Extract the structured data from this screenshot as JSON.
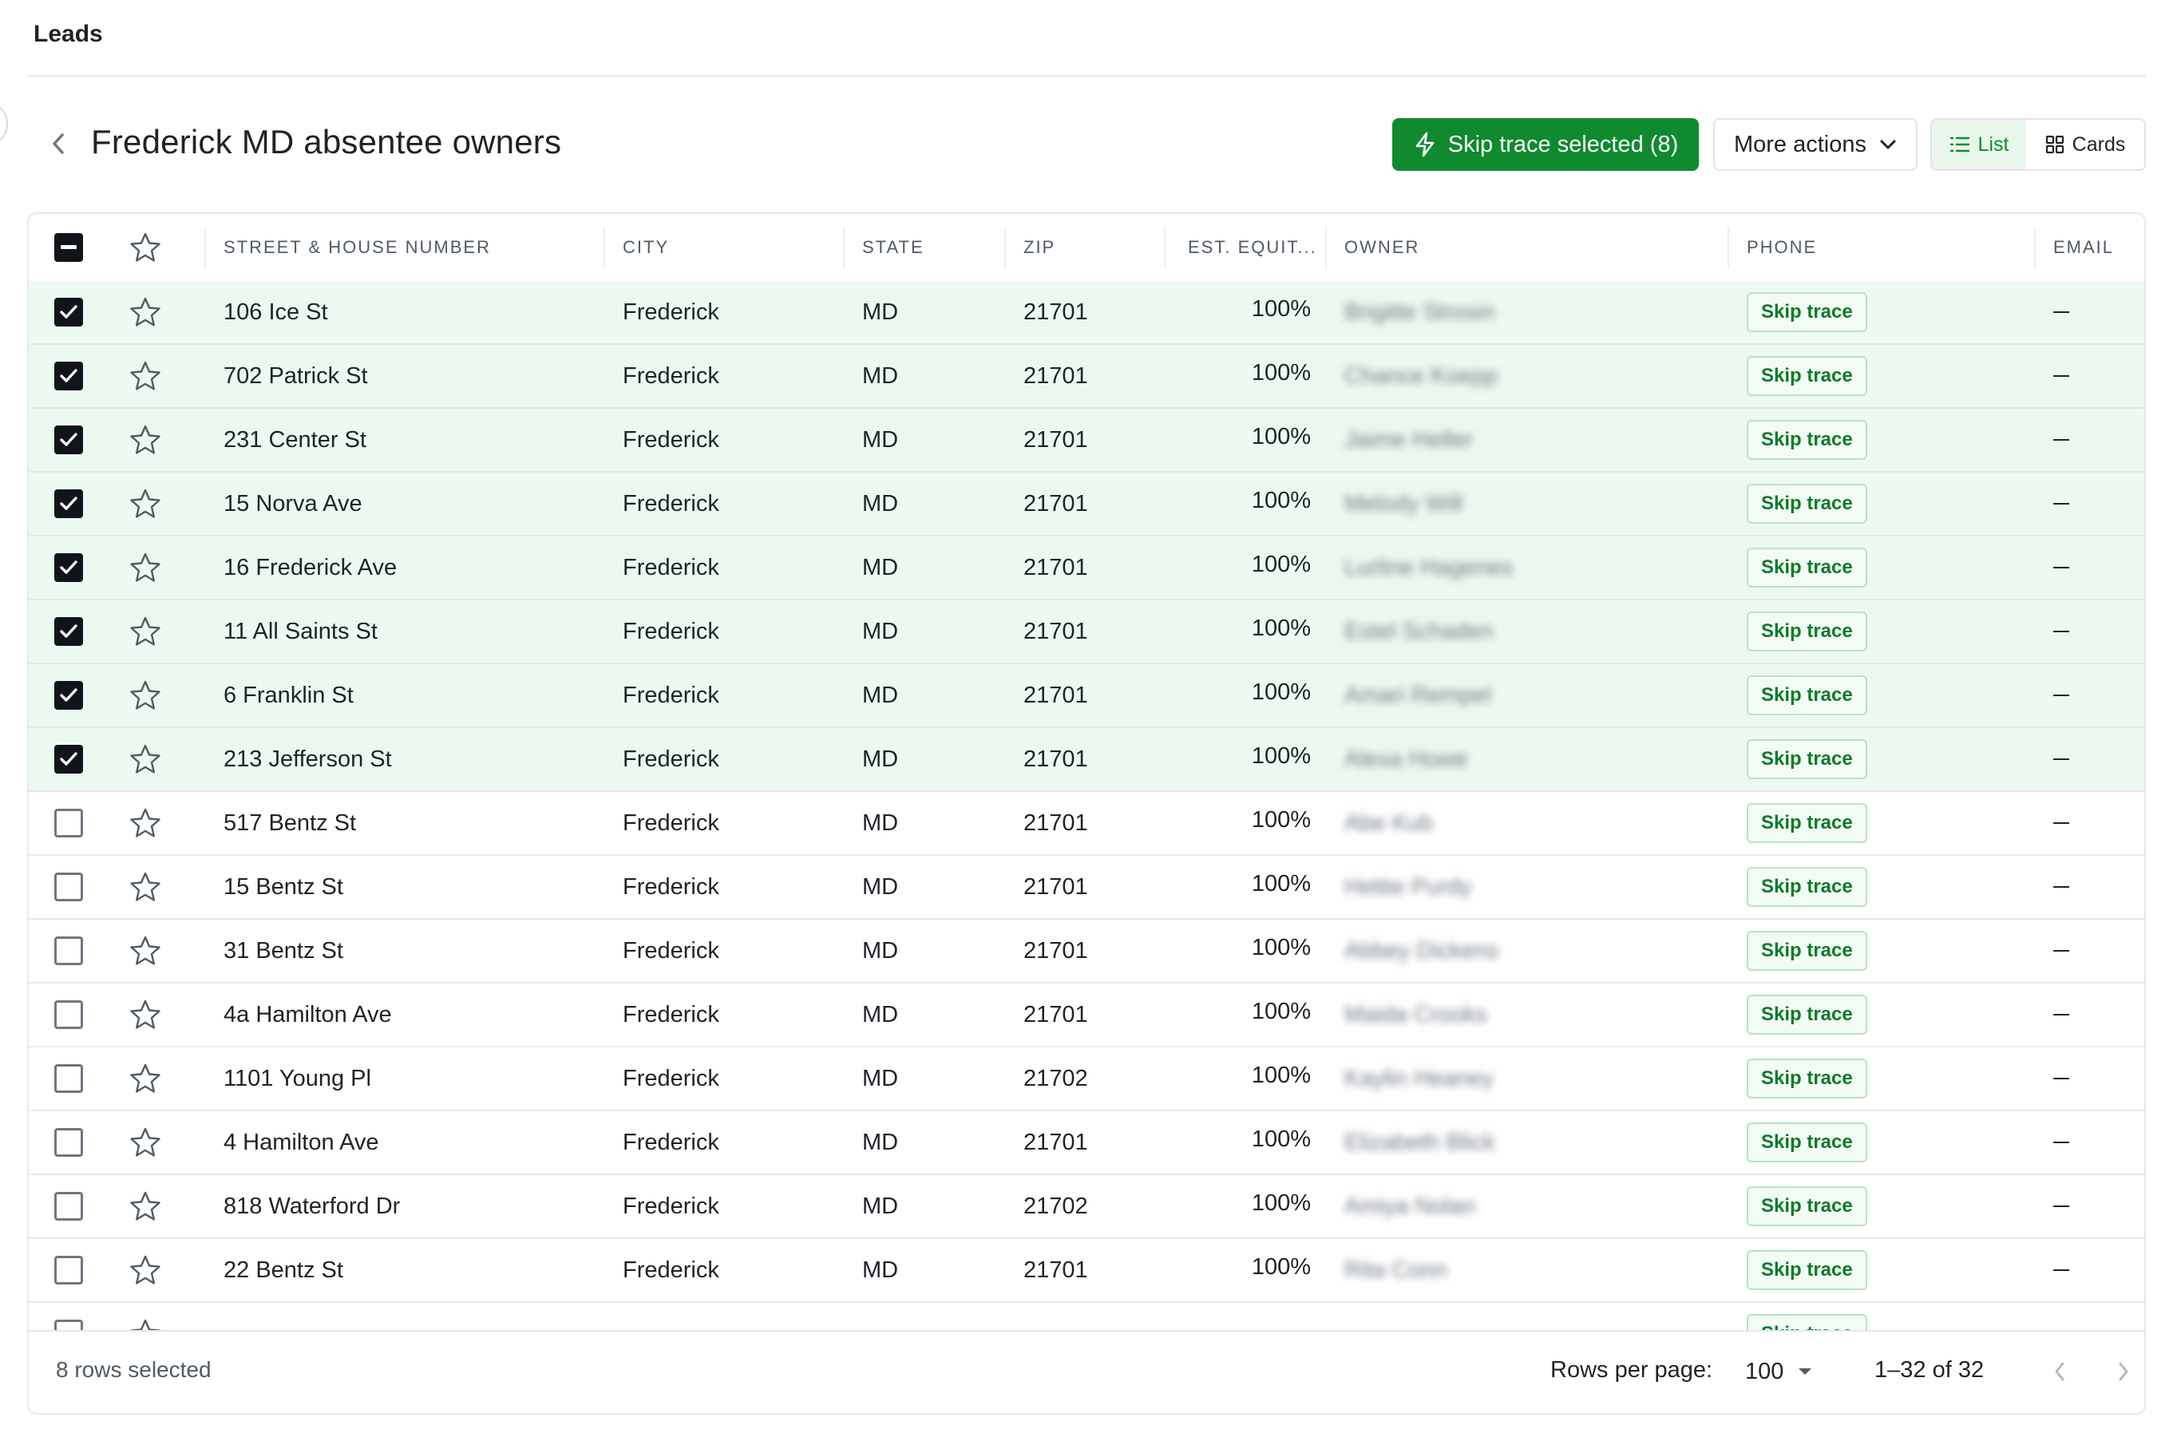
{
  "topbar": {
    "title": "Leads"
  },
  "header": {
    "title": "Frederick MD absentee owners",
    "skip_trace_selected_label": "Skip trace selected (8)",
    "more_actions_label": "More actions",
    "view_list_label": "List",
    "view_cards_label": "Cards",
    "active_view": "List"
  },
  "colors": {
    "primary": "#0f8a2f",
    "selected_row": "#ecf9f0",
    "skip_button_border": "#b9e2c5"
  },
  "table": {
    "columns": [
      "STREET & HOUSE NUMBER",
      "CITY",
      "STATE",
      "ZIP",
      "EST. EQUIT...",
      "OWNER",
      "PHONE",
      "EMAIL"
    ],
    "skip_trace_label": "Skip trace",
    "email_placeholder": "—",
    "rows": [
      {
        "selected": true,
        "street": "106 Ice St",
        "city": "Frederick",
        "state": "MD",
        "zip": "21701",
        "equity": "100%",
        "owner": "Brigitte Strosin"
      },
      {
        "selected": true,
        "street": "702 Patrick St",
        "city": "Frederick",
        "state": "MD",
        "zip": "21701",
        "equity": "100%",
        "owner": "Chance Koepp"
      },
      {
        "selected": true,
        "street": "231 Center St",
        "city": "Frederick",
        "state": "MD",
        "zip": "21701",
        "equity": "100%",
        "owner": "Jaime Heller"
      },
      {
        "selected": true,
        "street": "15 Norva Ave",
        "city": "Frederick",
        "state": "MD",
        "zip": "21701",
        "equity": "100%",
        "owner": "Melody Will"
      },
      {
        "selected": true,
        "street": "16 Frederick Ave",
        "city": "Frederick",
        "state": "MD",
        "zip": "21701",
        "equity": "100%",
        "owner": "Lurline Hagenes"
      },
      {
        "selected": true,
        "street": "11 All Saints St",
        "city": "Frederick",
        "state": "MD",
        "zip": "21701",
        "equity": "100%",
        "owner": "Estel Schaden"
      },
      {
        "selected": true,
        "street": "6 Franklin St",
        "city": "Frederick",
        "state": "MD",
        "zip": "21701",
        "equity": "100%",
        "owner": "Amari Rempel"
      },
      {
        "selected": true,
        "street": "213 Jefferson St",
        "city": "Frederick",
        "state": "MD",
        "zip": "21701",
        "equity": "100%",
        "owner": "Alexa Howe"
      },
      {
        "selected": false,
        "street": "517 Bentz St",
        "city": "Frederick",
        "state": "MD",
        "zip": "21701",
        "equity": "100%",
        "owner": "Abe Kub"
      },
      {
        "selected": false,
        "street": "15 Bentz St",
        "city": "Frederick",
        "state": "MD",
        "zip": "21701",
        "equity": "100%",
        "owner": "Hettie Purdy"
      },
      {
        "selected": false,
        "street": "31 Bentz St",
        "city": "Frederick",
        "state": "MD",
        "zip": "21701",
        "equity": "100%",
        "owner": "Abbey Dickens"
      },
      {
        "selected": false,
        "street": "4a Hamilton Ave",
        "city": "Frederick",
        "state": "MD",
        "zip": "21701",
        "equity": "100%",
        "owner": "Maida Crooks"
      },
      {
        "selected": false,
        "street": "1101 Young Pl",
        "city": "Frederick",
        "state": "MD",
        "zip": "21702",
        "equity": "100%",
        "owner": "Kaylin Heaney"
      },
      {
        "selected": false,
        "street": "4 Hamilton Ave",
        "city": "Frederick",
        "state": "MD",
        "zip": "21701",
        "equity": "100%",
        "owner": "Elizabeth Blick"
      },
      {
        "selected": false,
        "street": "818 Waterford Dr",
        "city": "Frederick",
        "state": "MD",
        "zip": "21702",
        "equity": "100%",
        "owner": "Amiya Nolan"
      },
      {
        "selected": false,
        "street": "22 Bentz St",
        "city": "Frederick",
        "state": "MD",
        "zip": "21701",
        "equity": "100%",
        "owner": "Rita Conn"
      }
    ]
  },
  "footer": {
    "selected_text": "8 rows selected",
    "rows_per_page_label": "Rows per page:",
    "rows_per_page_value": "100",
    "range_text": "1–32 of 32"
  },
  "icons": {
    "back": "chevron-left-icon",
    "skip_trace": "lightning-icon",
    "more_actions": "chevron-down-icon",
    "list_view": "list-icon",
    "cards_view": "grid-icon",
    "favorite": "star-outline-icon",
    "select_all": "indeterminate-checkbox-icon",
    "rows_per_page": "caret-down-icon",
    "prev_page": "chevron-left-icon",
    "next_page": "chevron-right-icon"
  }
}
